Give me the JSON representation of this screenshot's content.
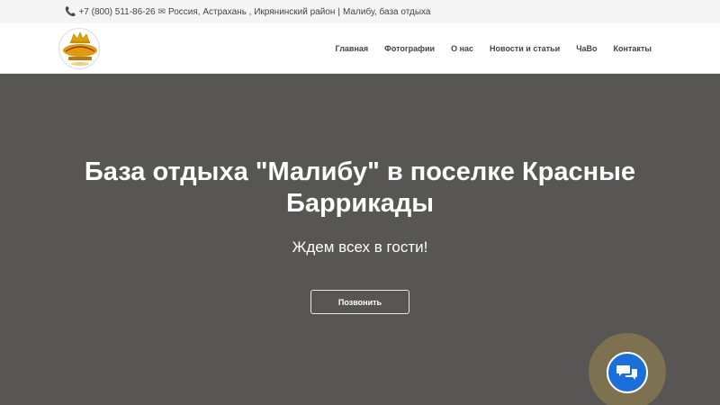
{
  "topbar": {
    "phone_icon": "phone-icon",
    "phone": "+7 (800) 511-86-26",
    "mail_icon": "mail-icon",
    "location": "Россия, Астрахань , Икрянинский район",
    "separator": "|",
    "site_name": "Малибу, база отдыха"
  },
  "header": {
    "logo_icon": "malibu-crown-logo",
    "nav": [
      {
        "label": "Главная"
      },
      {
        "label": "Фотографии"
      },
      {
        "label": "О нас"
      },
      {
        "label": "Новости и статьи"
      },
      {
        "label": "ЧаВо"
      },
      {
        "label": "Контакты"
      }
    ]
  },
  "hero": {
    "title": "База отдыха \"Малибу\" в поселке Красные Баррикады",
    "subtitle": "Ждем всех в гости!",
    "call_button": "Позвонить"
  },
  "chat": {
    "icon": "chat-bubbles-icon"
  },
  "colors": {
    "hero_bg": "#575654",
    "topbar_bg": "#f5f5f5",
    "chat_blue": "#1a6fd8",
    "chat_halo": "#7d7150",
    "logo_gold": "#e0a400"
  }
}
